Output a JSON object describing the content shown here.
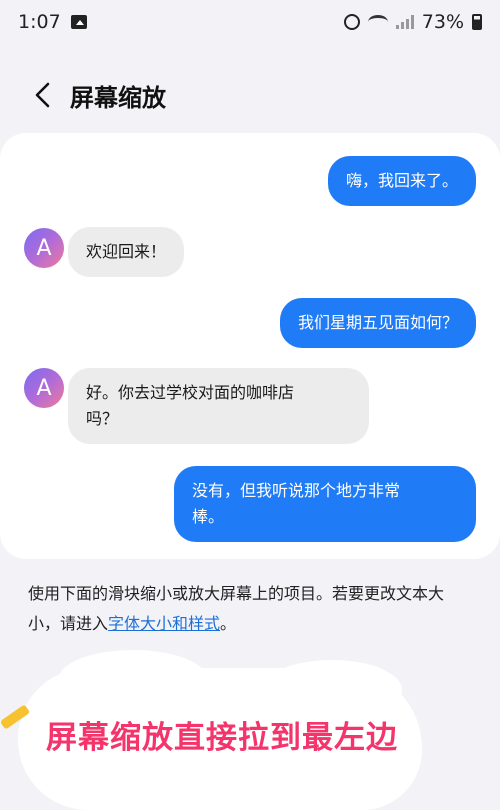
{
  "status": {
    "time": "1:07",
    "battery": "73%"
  },
  "header": {
    "title": "屏幕缩放"
  },
  "chat": {
    "messages": [
      {
        "dir": "out",
        "text": "嗨，我回来了。"
      },
      {
        "dir": "in",
        "avatar": "A",
        "text": "欢迎回来！"
      },
      {
        "dir": "out",
        "text": "我们星期五见面如何？"
      },
      {
        "dir": "in",
        "avatar": "A",
        "line1": "好。你去过学校对面的咖啡店",
        "line2": "吗？"
      },
      {
        "dir": "out",
        "line1": "没有，但我听说那个地方非常",
        "line2": "棒。"
      }
    ]
  },
  "description": {
    "line1": "使用下面的滑块缩小或放大屏幕上的项目。若要更改文本大",
    "line2_prefix": "小，请进入",
    "link": "字体大小和样式",
    "line2_suffix": "。"
  },
  "annotation": {
    "text": "屏幕缩放直接拉到最左边"
  }
}
